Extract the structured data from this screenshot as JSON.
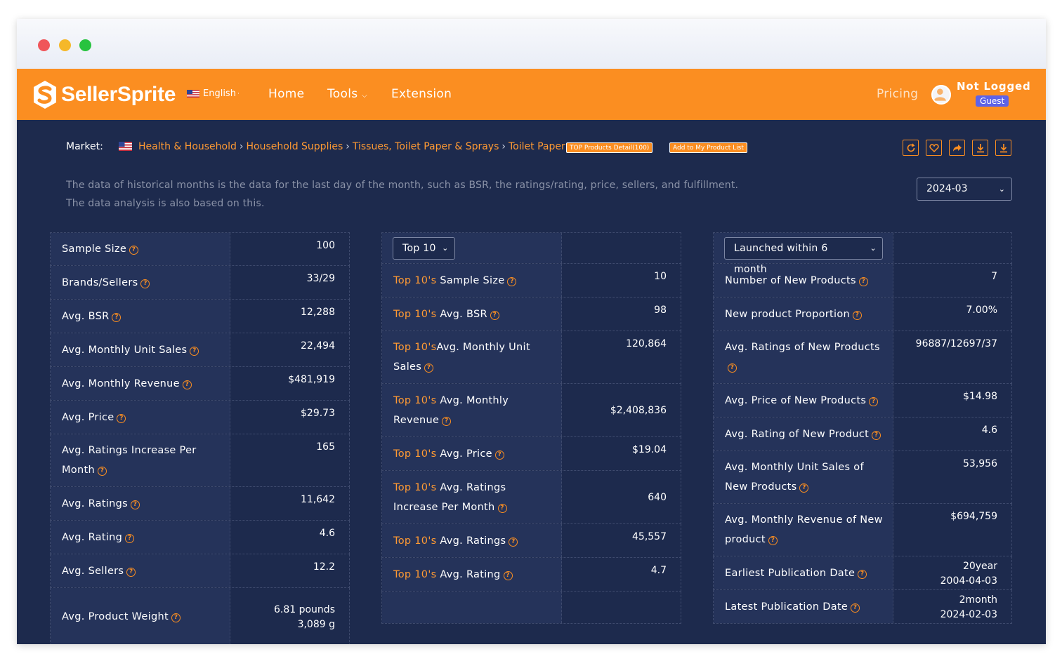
{
  "brand": {
    "name": "SellerSprite",
    "accent": "#fb8e21",
    "background": "#1d2a4d"
  },
  "nav": {
    "language": "English",
    "home": "Home",
    "tools": "Tools",
    "extension": "Extension",
    "pricing": "Pricing",
    "user_status": "Not Logged",
    "user_role": "Guest"
  },
  "market": {
    "label": "Market:",
    "flag_icon": "us-flag-icon",
    "breadcrumb": [
      "Health & Household",
      "Household Supplies",
      "Tissues, Toilet Paper & Sprays",
      "Toilet Paper"
    ],
    "tag_top_products": "TOP Products Detail(100)",
    "tag_add_list": "Add to My Product List"
  },
  "notice": {
    "line1": "The data of historical months is the data for the last day of the month, such as BSR, the ratings/rating, price, sellers, and fulfillment.",
    "line2": "The data analysis is also based on this."
  },
  "month_select": {
    "value": "2024-03"
  },
  "overall": [
    {
      "label": "Sample Size",
      "value": "100"
    },
    {
      "label": "Brands/Sellers",
      "value": "33/29"
    },
    {
      "label": "Avg. BSR",
      "value": "12,288"
    },
    {
      "label": "Avg. Monthly Unit Sales",
      "value": "22,494"
    },
    {
      "label": "Avg. Monthly Revenue",
      "value": "$481,919"
    },
    {
      "label": "Avg. Price",
      "value": "$29.73"
    },
    {
      "label": "Avg. Ratings Increase Per Month",
      "value": "165"
    },
    {
      "label": "Avg. Ratings",
      "value": "11,642"
    },
    {
      "label": "Avg. Rating",
      "value": "4.6"
    },
    {
      "label": "Avg. Sellers",
      "value": "12.2"
    },
    {
      "label": "Avg. Product Weight",
      "value": "6.81 pounds",
      "value2": "3,089 g"
    }
  ],
  "top": {
    "select": "Top 10",
    "prefix": "Top 10's",
    "rows": [
      {
        "label": "Sample Size",
        "value": "10"
      },
      {
        "label": "Avg. BSR",
        "value": "98"
      },
      {
        "label": "Avg. Monthly Unit Sales",
        "value": "120,864"
      },
      {
        "label": "Avg. Monthly Revenue",
        "value": "$2,408,836"
      },
      {
        "label": "Avg. Price",
        "value": "$19.04"
      },
      {
        "label": "Avg. Ratings Increase Per Month",
        "value": "640"
      },
      {
        "label": "Avg. Ratings",
        "value": "45,557"
      },
      {
        "label": "Avg. Rating",
        "value": "4.7"
      }
    ]
  },
  "new_products": {
    "select": "Launched within 6 month",
    "rows": [
      {
        "label": "Number of New Products",
        "value": "7"
      },
      {
        "label": "New product Proportion",
        "value": "7.00%"
      },
      {
        "label": "Avg. Ratings of New Products",
        "value": "96887/12697/37"
      },
      {
        "label": "Avg. Price of New Products",
        "value": "$14.98"
      },
      {
        "label": "Avg. Rating of New Product",
        "value": "4.6"
      },
      {
        "label": "Avg. Monthly Unit Sales of New Products",
        "value": "53,956"
      },
      {
        "label": "Avg. Monthly Revenue of New product",
        "value": "$694,759"
      },
      {
        "label": "Earliest Publication Date",
        "value": "20year",
        "value2": "2004-04-03"
      },
      {
        "label": "Latest Publication Date",
        "value": "2month",
        "value2": "2024-02-03"
      }
    ]
  }
}
